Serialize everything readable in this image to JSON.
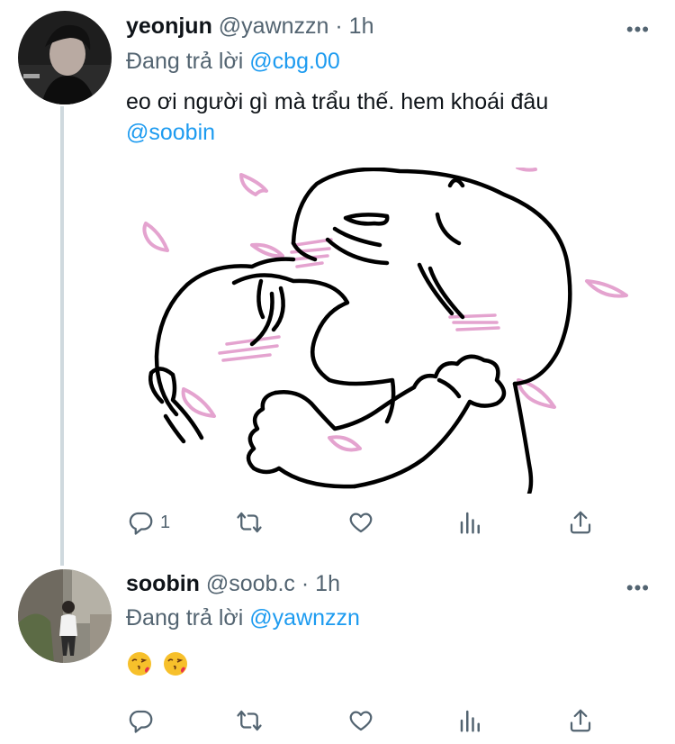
{
  "tweets": [
    {
      "display_name": "yeonjun",
      "handle": "@yawnzzn",
      "time": "· 1h",
      "reply_prefix": "Đang trả lời",
      "reply_to": "@cbg.00",
      "text": "eo ơi người gì mà trẩu thế. hem khoái đâu",
      "mention": "@soobin",
      "reply_count": "1"
    },
    {
      "display_name": "soobin",
      "handle": "@soob.c",
      "time": "· 1h",
      "reply_prefix": "Đang trả lời",
      "reply_to": "@yawnzzn",
      "emojis": [
        "face-blowing-a-kiss",
        "face-blowing-a-kiss"
      ]
    }
  ],
  "more_label": "•••",
  "icons": [
    "reply-icon",
    "retweet-icon",
    "like-icon",
    "analytics-icon",
    "share-icon"
  ],
  "colors": {
    "link": "#1d9bf0",
    "muted": "#536471",
    "thread_line": "#cfd9de",
    "petal": "#e8a9d2"
  }
}
